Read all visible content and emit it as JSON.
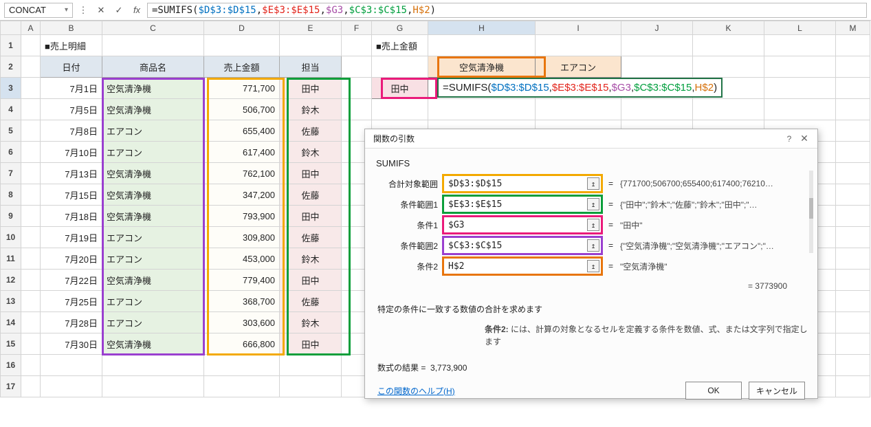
{
  "namebox": "CONCAT",
  "formula_raw": "=SUMIFS($D$3:$D$15,$E$3:$E$15,$G3,$C$3:$C$15,H$2)",
  "formula_parts": [
    {
      "t": "=SUMIFS(",
      "c": ""
    },
    {
      "t": "$D$3:$D$15",
      "c": "a-blue"
    },
    {
      "t": ",",
      "c": ""
    },
    {
      "t": "$E$3:$E$15",
      "c": "a-red"
    },
    {
      "t": ",",
      "c": ""
    },
    {
      "t": "$G3",
      "c": "a-purple"
    },
    {
      "t": ",",
      "c": ""
    },
    {
      "t": "$C$3:$C$15",
      "c": "a-green"
    },
    {
      "t": ",",
      "c": ""
    },
    {
      "t": "H$2",
      "c": "a-orange"
    },
    {
      "t": ")",
      "c": ""
    }
  ],
  "columns": [
    "A",
    "B",
    "C",
    "D",
    "E",
    "F",
    "G",
    "H",
    "I",
    "J",
    "K",
    "L",
    "M"
  ],
  "row_count": 17,
  "titles": {
    "left": "■売上明細",
    "right": "■売上金額"
  },
  "left_headers": {
    "date": "日付",
    "product": "商品名",
    "amount": "売上金額",
    "staff": "担当"
  },
  "right_headers": {
    "h2": "空気清浄機",
    "i2": "エアコン",
    "g3": "田中"
  },
  "left_rows": [
    {
      "date": "7月1日",
      "product": "空気清浄機",
      "amount": "771,700",
      "staff": "田中"
    },
    {
      "date": "7月5日",
      "product": "空気清浄機",
      "amount": "506,700",
      "staff": "鈴木"
    },
    {
      "date": "7月8日",
      "product": "エアコン",
      "amount": "655,400",
      "staff": "佐藤"
    },
    {
      "date": "7月10日",
      "product": "エアコン",
      "amount": "617,400",
      "staff": "鈴木"
    },
    {
      "date": "7月13日",
      "product": "空気清浄機",
      "amount": "762,100",
      "staff": "田中"
    },
    {
      "date": "7月15日",
      "product": "空気清浄機",
      "amount": "347,200",
      "staff": "佐藤"
    },
    {
      "date": "7月18日",
      "product": "空気清浄機",
      "amount": "793,900",
      "staff": "田中"
    },
    {
      "date": "7月19日",
      "product": "エアコン",
      "amount": "309,800",
      "staff": "佐藤"
    },
    {
      "date": "7月20日",
      "product": "エアコン",
      "amount": "453,000",
      "staff": "鈴木"
    },
    {
      "date": "7月22日",
      "product": "空気清浄機",
      "amount": "779,400",
      "staff": "田中"
    },
    {
      "date": "7月25日",
      "product": "エアコン",
      "amount": "368,700",
      "staff": "佐藤"
    },
    {
      "date": "7月28日",
      "product": "エアコン",
      "amount": "303,600",
      "staff": "鈴木"
    },
    {
      "date": "7月30日",
      "product": "空気清浄機",
      "amount": "666,800",
      "staff": "田中"
    }
  ],
  "dialog": {
    "title": "関数の引数",
    "fn": "SUMIFS",
    "args": [
      {
        "label": "合計対象範囲",
        "value": "$D$3:$D$15",
        "result": "{771700;506700;655400;617400;76210…",
        "hl": "orange"
      },
      {
        "label": "条件範囲1",
        "value": "$E$3:$E$15",
        "result": "{\"田中\";\"鈴木\";\"佐藤\";\"鈴木\";\"田中\";\"…",
        "hl": "green"
      },
      {
        "label": "条件1",
        "value": "$G3",
        "result": "\"田中\"",
        "hl": "magenta"
      },
      {
        "label": "条件範囲2",
        "value": "$C$3:$C$15",
        "result": "{\"空気清浄機\";\"空気清浄機\";\"エアコン\";\"…",
        "hl": "purple"
      },
      {
        "label": "条件2",
        "value": "H$2",
        "result": "\"空気清浄機\"",
        "hl": "orange2"
      }
    ],
    "sum_result": "= 3773900",
    "desc": "特定の条件に一致する数値の合計を求めます",
    "crit_label": "条件2:",
    "crit_desc": "には、計算の対象となるセルを定義する条件を数値、式、または文字列で指定します",
    "result_label": "数式の結果 =",
    "result_value": "3,773,900",
    "help": "この関数のヘルプ(H)",
    "ok": "OK",
    "cancel": "キャンセル"
  }
}
